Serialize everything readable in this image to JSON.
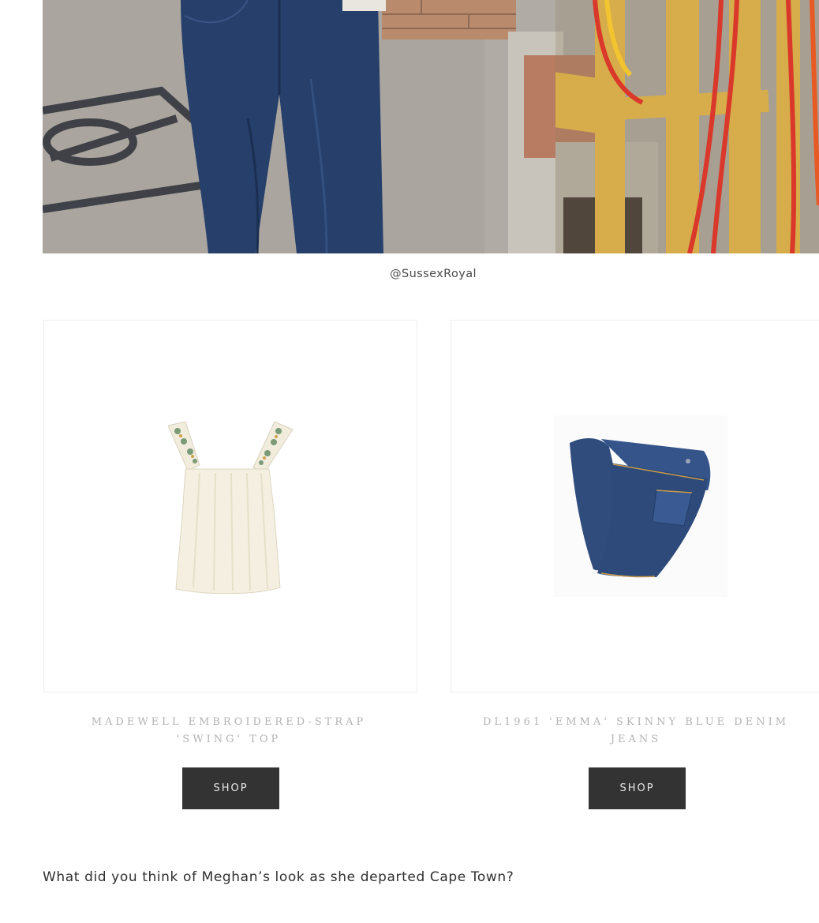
{
  "photo": {
    "alt_subject": "jeans-and-fence-street-photo",
    "colors": {
      "pavement": "#a8a39c",
      "denim": "#263f6b",
      "fence": "#d6ad4a",
      "ribbon_red": "#d9382a",
      "ribbon_yellow": "#f2c430",
      "brick": "#b98a6c"
    }
  },
  "photo_credit": "@SussexRoyal",
  "products": [
    {
      "name": "MADEWELL EMBROIDERED-STRAP 'SWING' TOP",
      "button_label": "SHOP",
      "image": "cream-swing-top-image"
    },
    {
      "name": "DL1961 'EMMA' SKINNY BLUE DENIM JEANS",
      "button_label": "SHOP",
      "image": "blue-skinny-jeans-image"
    }
  ],
  "closing_question": "What did you think of Meghan’s look as she departed Cape Town?",
  "colors": {
    "button_bg": "#333333",
    "button_text": "#e9e9e9",
    "product_name": "#b3b3b3"
  }
}
